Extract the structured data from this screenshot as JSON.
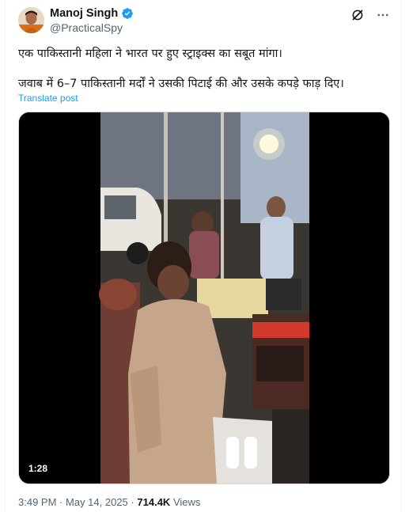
{
  "author": {
    "name": "Manoj Singh",
    "handle": "@PracticalSpy",
    "verified": true,
    "avatar_icon": "user-avatar-photo"
  },
  "tweet": {
    "line1": "एक पाकिस्तानी महिला ने भारत पर हुए स्ट्राइक्स का सबूत मांगा।",
    "line2": "जवाब में 6–7 पाकिस्तानी मर्दों ने उसकी पिटाई की और उसके कपड़े फाड़ दिए।",
    "translate_label": "Translate post"
  },
  "video": {
    "duration": "1:28"
  },
  "meta": {
    "time": "3:49 PM",
    "separator": "·",
    "date": "May 14, 2025",
    "views_count": "714.4K",
    "views_label": "Views"
  },
  "icons": {
    "grok": "grok-icon",
    "more": "more-options-icon",
    "verified": "verified-badge-icon"
  },
  "colors": {
    "link": "#1d9bf0",
    "secondary_text": "#536471",
    "primary_text": "#0f1419"
  }
}
